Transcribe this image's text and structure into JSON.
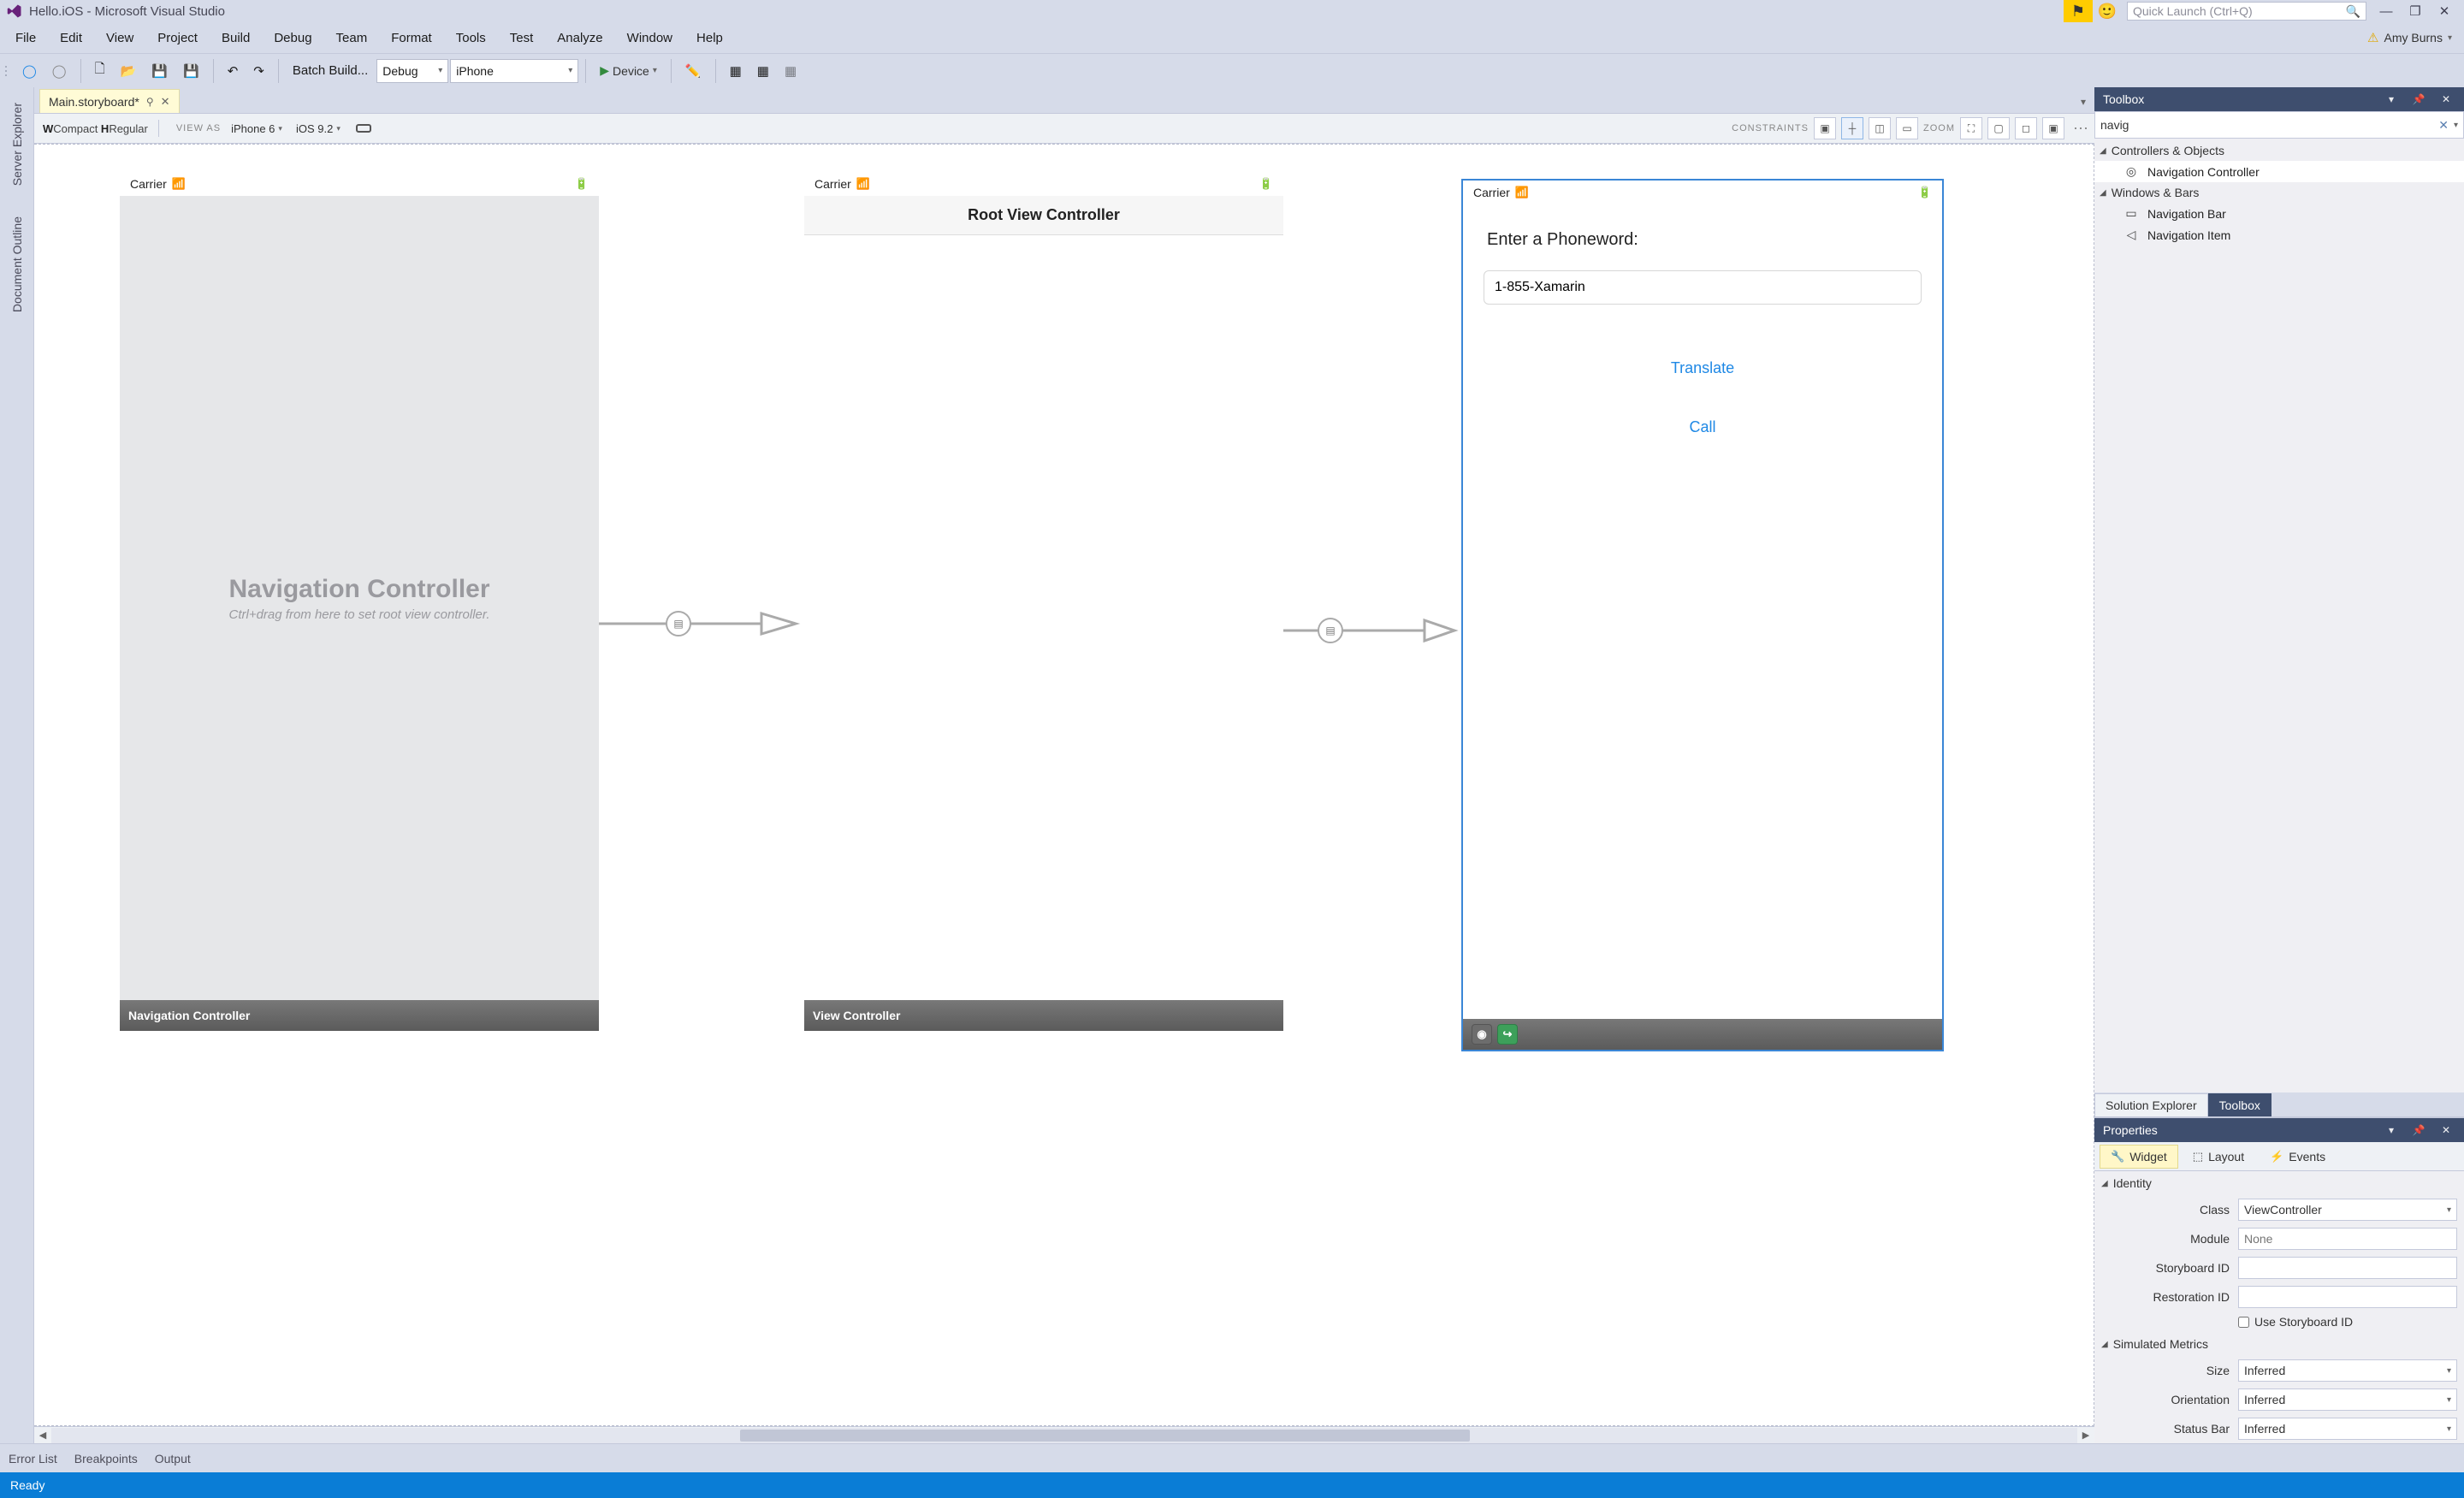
{
  "window": {
    "title": "Hello.iOS - Microsoft Visual Studio",
    "quicklaunch_placeholder": "Quick Launch (Ctrl+Q)",
    "user": "Amy Burns"
  },
  "menu": [
    "File",
    "Edit",
    "View",
    "Project",
    "Build",
    "Debug",
    "Team",
    "Format",
    "Tools",
    "Test",
    "Analyze",
    "Window",
    "Help"
  ],
  "toolbar": {
    "batch_build": "Batch Build...",
    "config": "Debug",
    "platform": "iPhone",
    "device": "Device"
  },
  "doc": {
    "tab_name": "Main.storyboard*",
    "size_class": {
      "w": "W",
      "wval": "Compact ",
      "h": "H",
      "hval": "Regular"
    },
    "view_as_label": "VIEW AS",
    "device": "iPhone 6",
    "ios": "iOS 9.2",
    "constraints_label": "CONSTRAINTS",
    "zoom_label": "ZOOM"
  },
  "left_rail": [
    "Server Explorer",
    "Document Outline"
  ],
  "scenes": {
    "nav": {
      "carrier": "Carrier",
      "title": "Navigation Controller",
      "hint": "Ctrl+drag from here to set root view controller.",
      "footer": "Navigation Controller"
    },
    "root": {
      "carrier": "Carrier",
      "nav_title": "Root View Controller",
      "footer": "View Controller"
    },
    "phoneword": {
      "carrier": "Carrier",
      "label": "Enter a Phoneword:",
      "input_value": "1-855-Xamarin",
      "btn_translate": "Translate",
      "btn_call": "Call"
    }
  },
  "toolbox": {
    "title": "Toolbox",
    "search": "navig",
    "groups": {
      "controllers": "Controllers & Objects",
      "windows": "Windows & Bars"
    },
    "items": {
      "nav_controller": "Navigation Controller",
      "nav_bar": "Navigation Bar",
      "nav_item": "Navigation Item"
    },
    "tabs": {
      "solution": "Solution Explorer",
      "toolbox": "Toolbox"
    }
  },
  "properties": {
    "title": "Properties",
    "tabs": {
      "widget": "Widget",
      "layout": "Layout",
      "events": "Events"
    },
    "sections": {
      "identity": "Identity",
      "simulated": "Simulated Metrics"
    },
    "rows": {
      "class_lbl": "Class",
      "class_val": "ViewController",
      "module_lbl": "Module",
      "module_ph": "None",
      "storyboardid_lbl": "Storyboard ID",
      "restorationid_lbl": "Restoration ID",
      "use_sb_id": "Use Storyboard ID",
      "size_lbl": "Size",
      "size_val": "Inferred",
      "orient_lbl": "Orientation",
      "orient_val": "Inferred",
      "status_lbl": "Status Bar",
      "status_val": "Inferred"
    }
  },
  "footer_tabs": [
    "Error List",
    "Breakpoints",
    "Output"
  ],
  "status": "Ready"
}
